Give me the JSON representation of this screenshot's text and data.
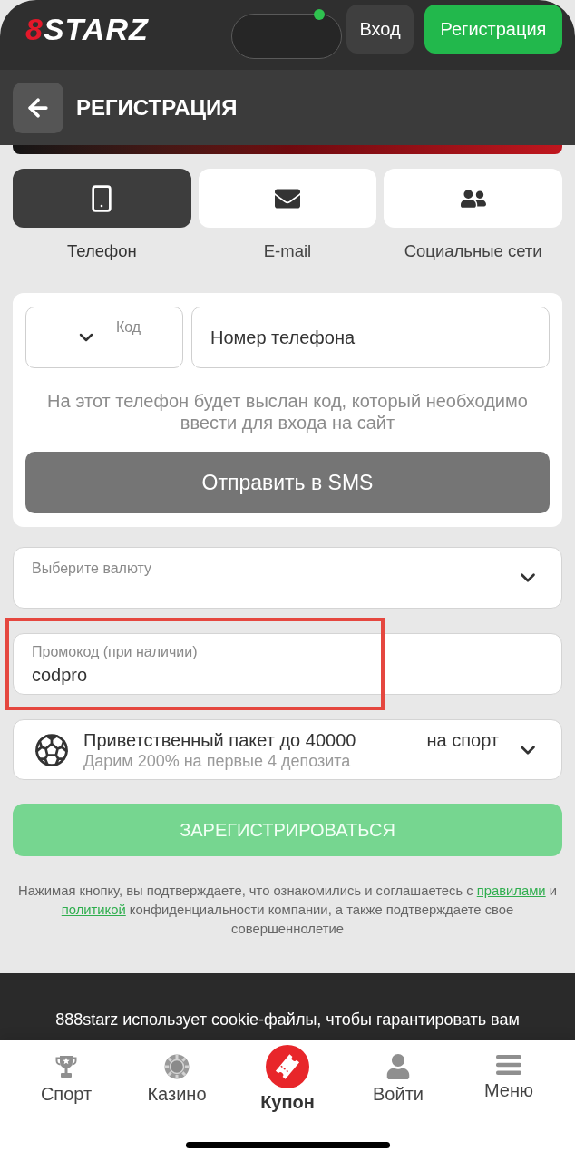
{
  "header": {
    "logo": {
      "accent": "8",
      "name": "STARZ"
    },
    "buttons": [
      {
        "label": "Вход",
        "kind": "secondary"
      },
      {
        "label": "Регистрация",
        "kind": "primary"
      }
    ]
  },
  "page_title": "РЕГИСТРАЦИЯ",
  "method_tabs": [
    {
      "label": "Телефон",
      "selected": true
    },
    {
      "label": "E-mail",
      "selected": false
    },
    {
      "label": "Социальные сети",
      "selected": false
    }
  ],
  "phone_form": {
    "code_select": {
      "label": "Код"
    },
    "phone_field": {
      "placeholder": "Номер телефона"
    },
    "hint": "На этот телефон будет выслан код, который необходимо ввести для входа на сайт",
    "send_button": "Отправить в SMS"
  },
  "currency_select": {
    "label": "Выберите валюту"
  },
  "promo_field": {
    "label": "Промокод (при наличии)",
    "value": "codpro",
    "highlighted": true
  },
  "bonus_select": {
    "title": "Приветственный пакет до 40000",
    "tag": "на спорт",
    "subtitle": "Дарим 200% на первые 4 депозита"
  },
  "register_button": {
    "label": "ЗАРЕГИСТРИРОВАТЬСЯ",
    "disabled": true
  },
  "legal_text": [
    {
      "kind": "text",
      "text": "Нажимая кнопку, вы подтверждаете, что ознакомились и соглашаетесь с "
    },
    {
      "kind": "link",
      "text": "правилами"
    },
    {
      "kind": "text",
      "text": " и "
    },
    {
      "kind": "link",
      "text": "политикой"
    },
    {
      "kind": "text",
      "text": " конфиденциальности компании, а также подтверждаете свое совершеннолетие"
    }
  ],
  "cookie_notice": "888starz использует cookie-файлы, чтобы гарантировать вам",
  "bottom_nav": [
    {
      "label": "Спорт",
      "kind": "tab"
    },
    {
      "label": "Казино",
      "kind": "tab"
    },
    {
      "label": "Купон",
      "kind": "featured"
    },
    {
      "label": "Войти",
      "kind": "tab"
    },
    {
      "label": "Меню",
      "kind": "tab"
    }
  ]
}
